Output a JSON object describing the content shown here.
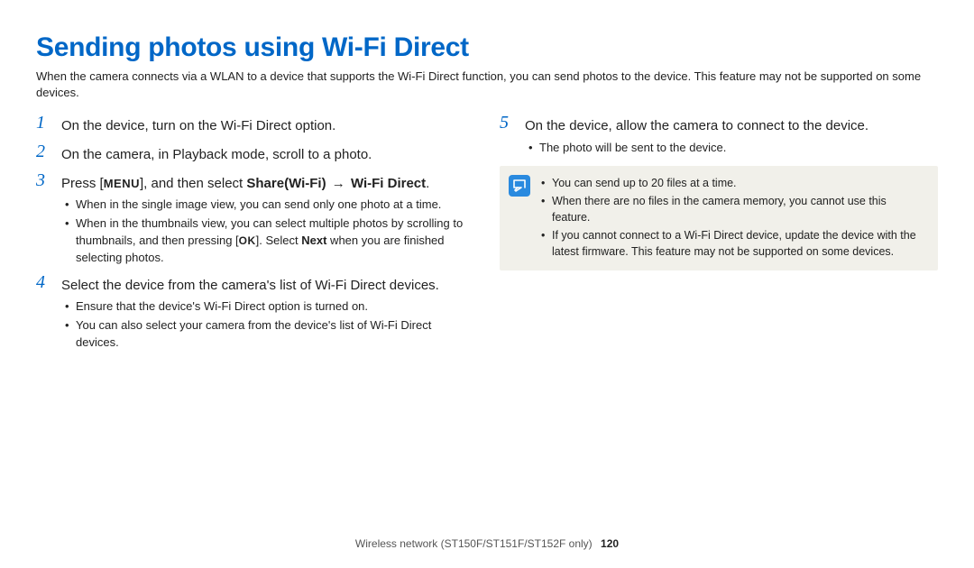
{
  "title": "Sending photos using Wi-Fi Direct",
  "intro": "When the camera connects via a WLAN to a device that supports the Wi-Fi Direct function, you can send photos to the device. This feature may not be supported on some devices.",
  "left": {
    "step1": {
      "num": "1",
      "text": "On the device, turn on the Wi-Fi Direct option."
    },
    "step2": {
      "num": "2",
      "text": "On the camera, in Playback mode, scroll to a photo."
    },
    "step3": {
      "num": "3",
      "prefix": "Press [",
      "menu": "MENU",
      "mid": "], and then select ",
      "share": "Share(Wi-Fi)",
      "arrow": " → ",
      "wifidirect": "Wi-Fi Direct",
      "suffix": ".",
      "bullets": [
        "When in the single image view, you can send only one photo at a time."
      ],
      "bullet2_a": "When in the thumbnails view, you can select multiple photos by scrolling to thumbnails, and then pressing [",
      "bullet2_ok": "OK",
      "bullet2_b": "]. Select ",
      "bullet2_next": "Next",
      "bullet2_c": " when you are finished selecting photos."
    },
    "step4": {
      "num": "4",
      "text": "Select the device from the camera's list of Wi-Fi Direct devices.",
      "bullets": [
        "Ensure that the device's Wi-Fi Direct option is turned on.",
        "You can also select your camera from the device's list of Wi-Fi Direct devices."
      ]
    }
  },
  "right": {
    "step5": {
      "num": "5",
      "text": "On the device, allow the camera to connect to the device.",
      "bullets": [
        "The photo will be sent to the device."
      ]
    },
    "notebox": {
      "items": [
        "You can send up to 20 files at a time.",
        "When there are no files in the camera memory, you cannot use this feature.",
        "If you cannot connect to a Wi-Fi Direct device, update the device with the latest firmware. This feature may not be supported on some devices."
      ]
    }
  },
  "footer": {
    "section": "Wireless network  (ST150F/ST151F/ST152F only)",
    "page": "120"
  }
}
